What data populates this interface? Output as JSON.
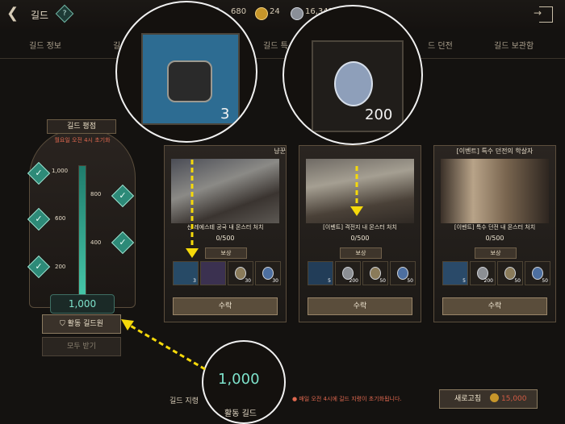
{
  "topbar": {
    "title": "길드",
    "help_icon": "?",
    "currencies": [
      {
        "value": "680",
        "icon": "gem-icon"
      },
      {
        "value": "24",
        "icon": "gold-coin-icon"
      },
      {
        "value": "16,341",
        "icon": "silver-coin-icon"
      }
    ]
  },
  "tabs": [
    "길드 정보",
    "길",
    "길드 특",
    "드 던전",
    "길드 보관함"
  ],
  "rating": {
    "header": "길드 평점",
    "reset_note": "월요일 오전 4시 초기화",
    "ticks": [
      "1,000",
      "800",
      "600",
      "400",
      "200"
    ],
    "score": "1,000",
    "progress_fraction": 1.0,
    "active_member_label": "활동 길드원",
    "receive_all_label": "모두 받기"
  },
  "cards": [
    {
      "title": "냥꾼",
      "desc": "신      레에스테 공국 내 몬스터 처치",
      "progress": "0/500",
      "reward_label": "보상",
      "rewards": [
        {
          "qty": "3"
        },
        {
          "qty": ""
        },
        {
          "qty": "30"
        },
        {
          "qty": "30"
        }
      ],
      "accept_label": "수락"
    },
    {
      "title": "",
      "desc": "[이벤트] 격전지 내 몬스터 처치",
      "progress": "0/500",
      "reward_label": "보상",
      "rewards": [
        {
          "qty": "5"
        },
        {
          "qty": "200"
        },
        {
          "qty": "50"
        },
        {
          "qty": "50"
        }
      ],
      "accept_label": "수락"
    },
    {
      "title": "[이벤트] 특수 던전의 학살자",
      "desc": "[이벤트] 특수 던전 내 몬스터 처치",
      "progress": "0/500",
      "reward_label": "보상",
      "rewards": [
        {
          "qty": "5"
        },
        {
          "qty": "200"
        },
        {
          "qty": "50"
        },
        {
          "qty": "50"
        }
      ],
      "accept_label": "수락"
    }
  ],
  "magnifiers": {
    "item_qty": "3",
    "coin_qty": "200",
    "score": "1,000",
    "member_hint": "활동 길드"
  },
  "bottom": {
    "label": "길드 지령",
    "warning": "매일 오전 4시에 길드 지령이 초기화됩니다.",
    "refresh_label": "새로고침",
    "refresh_cost": "15,000"
  }
}
